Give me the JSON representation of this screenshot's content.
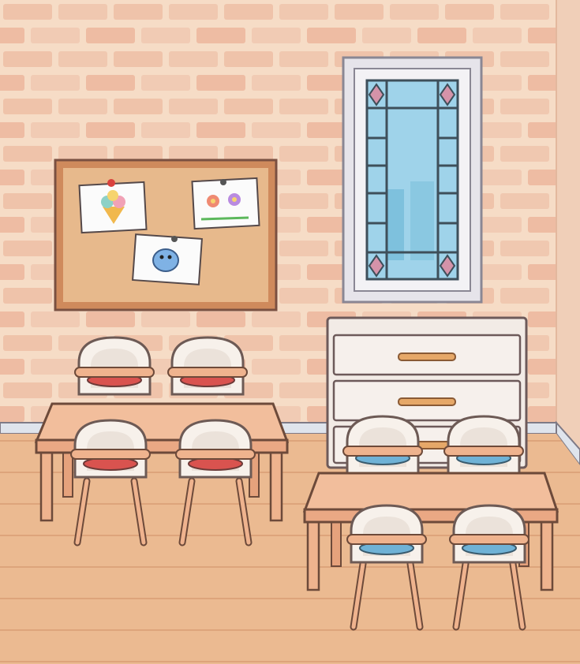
{
  "scene": {
    "room": "classroom",
    "colors": {
      "wall": "#f6dcc6",
      "brick": "#eebfa6",
      "brick_dark": "#e9ae92",
      "floor": "#e9b88f",
      "cork": "#e4b789",
      "frame": "#cf8a5c",
      "table": "#efb38e",
      "chair_shell": "#f6efe8",
      "seat_red": "#d9534f",
      "seat_blue": "#6fb2d6",
      "dresser": "#f0e9e4",
      "handle": "#e6a868",
      "window_frame": "#e3e1e6",
      "glass": "#a9d6ea",
      "diamond": "#cf91a6"
    }
  },
  "bulletin_board": {
    "drawings": [
      {
        "name": "ice-cream-drawing"
      },
      {
        "name": "flowers-drawing"
      },
      {
        "name": "bug-drawing"
      }
    ]
  },
  "dresser": {
    "drawer_count": 3
  },
  "tables": [
    {
      "name": "left-table",
      "seat_color": "red",
      "chairs": 4
    },
    {
      "name": "right-table",
      "seat_color": "blue",
      "chairs": 4
    }
  ]
}
